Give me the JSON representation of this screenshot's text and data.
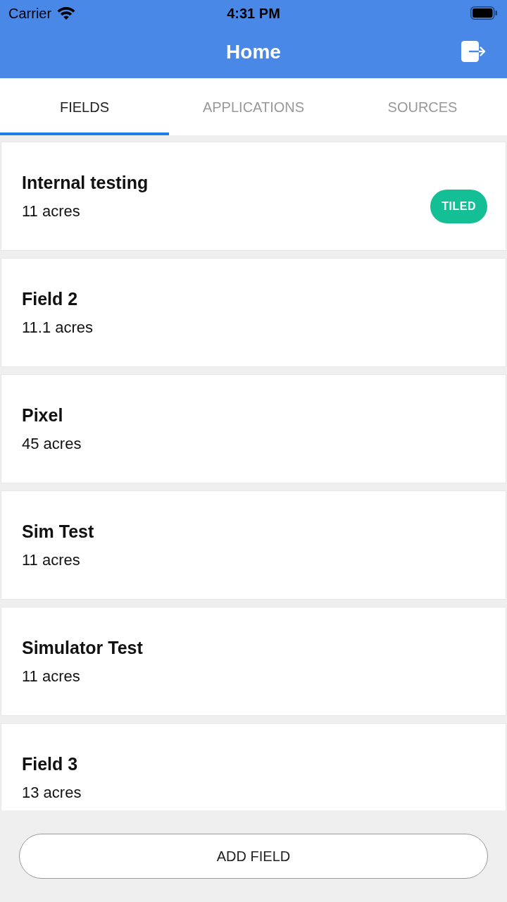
{
  "status_bar": {
    "carrier": "Carrier",
    "time": "4:31 PM"
  },
  "nav_bar": {
    "title": "Home"
  },
  "tabs": [
    {
      "label": "FIELDS",
      "selected": true
    },
    {
      "label": "APPLICATIONS",
      "selected": false
    },
    {
      "label": "SOURCES",
      "selected": false
    }
  ],
  "fields": [
    {
      "name": "Internal testing",
      "area": "11 acres",
      "badge": "TILED"
    },
    {
      "name": "Field 2",
      "area": "11.1 acres"
    },
    {
      "name": "Pixel",
      "area": "45 acres"
    },
    {
      "name": "Sim Test",
      "area": "11 acres"
    },
    {
      "name": "Simulator Test",
      "area": "11 acres"
    },
    {
      "name": "Field 3",
      "area": "13 acres"
    }
  ],
  "add_button": {
    "label": "ADD FIELD"
  }
}
